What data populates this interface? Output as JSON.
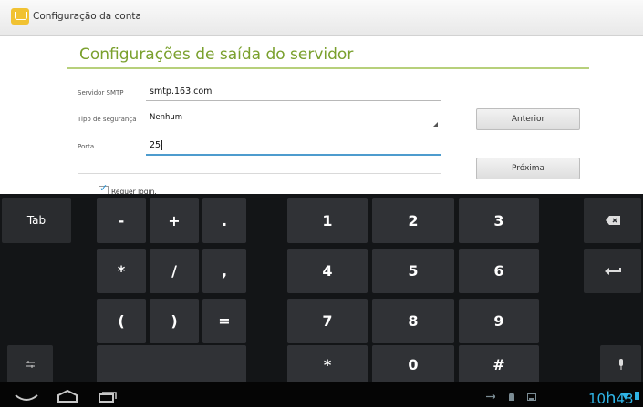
{
  "window": {
    "title": "Configuração da conta"
  },
  "page": {
    "heading": "Configurações de saída do servidor"
  },
  "fields": {
    "smtp": {
      "label": "Servidor SMTP",
      "value": "smtp.163.com"
    },
    "security": {
      "label": "Tipo de segurança",
      "value": "Nenhum"
    },
    "port": {
      "label": "Porta",
      "value": "25"
    },
    "login": {
      "label": "Requer login.",
      "checked": true
    }
  },
  "buttons": {
    "previous": "Anterior",
    "next": "Próxima"
  },
  "keyboard": {
    "tab": "Tab",
    "symbols": [
      "-",
      "+",
      ".",
      "*",
      "/",
      ",",
      "(",
      ")",
      "="
    ],
    "digits": [
      "1",
      "2",
      "3",
      "4",
      "5",
      "6",
      "7",
      "8",
      "9"
    ],
    "bottom": [
      "*",
      "0",
      "#"
    ],
    "backspace_icon": "backspace-icon",
    "enter_icon": "enter-icon",
    "settings_icon": "keyboard-settings-icon",
    "mic_icon": "microphone-icon"
  },
  "status": {
    "time_hours": "10",
    "time_h": "h",
    "time_minutes": "43",
    "wifi_icon": "wifi-icon",
    "battery_icon": "battery-icon",
    "accent": "#2fb4e6"
  }
}
